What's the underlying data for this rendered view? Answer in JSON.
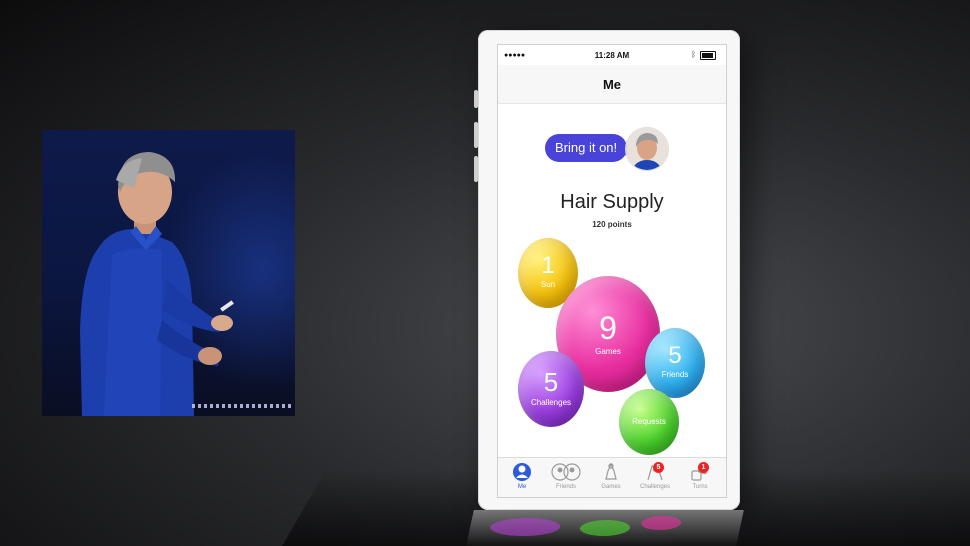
{
  "status_bar": {
    "signal": "●●●●● ",
    "time": "11:28 AM"
  },
  "nav": {
    "title": "Me"
  },
  "profile": {
    "status_message": "Bring it on!",
    "player_name": "Hair Supply",
    "points": "120 points"
  },
  "bubbles": [
    {
      "id": "sun",
      "value": "1",
      "label": "Sun",
      "color": "#f5c20d"
    },
    {
      "id": "games",
      "value": "9",
      "label": "Games",
      "color": "#e82fa0"
    },
    {
      "id": "friends",
      "value": "5",
      "label": "Friends",
      "color": "#2fb1f0"
    },
    {
      "id": "challenges",
      "value": "5",
      "label": "Challenges",
      "color": "#9b3ee0"
    },
    {
      "id": "requests",
      "value": "",
      "label": "Requests",
      "color": "#4fd32e"
    }
  ],
  "tabs": [
    {
      "label": "Me",
      "icon": "person-icon",
      "active": true,
      "badge": ""
    },
    {
      "label": "Friends",
      "icon": "friends-icon",
      "active": false,
      "badge": ""
    },
    {
      "label": "Games",
      "icon": "games-icon",
      "active": false,
      "badge": ""
    },
    {
      "label": "Challenges",
      "icon": "flags-icon",
      "active": false,
      "badge": "5"
    },
    {
      "label": "Turns",
      "icon": "dice-icon",
      "active": false,
      "badge": "1"
    }
  ],
  "colors": {
    "accent": "#2c5bd9",
    "bubble_message": "#4a43d9",
    "badge": "#e22222"
  }
}
